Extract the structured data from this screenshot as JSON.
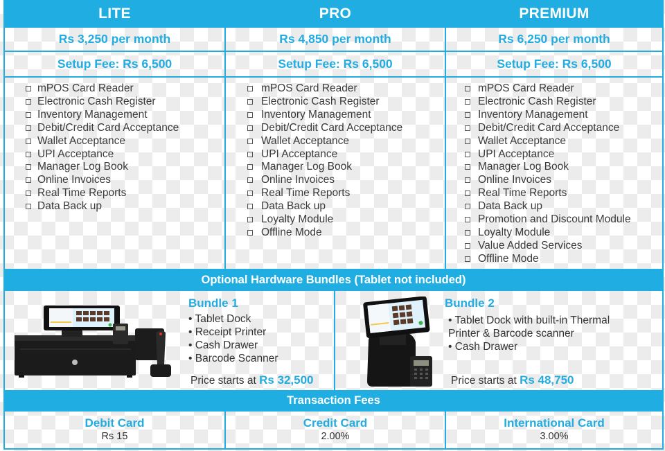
{
  "plans": [
    {
      "name": "LITE",
      "price": "Rs 3,250 per month",
      "setup_fee": "Setup Fee: Rs 6,500",
      "features": [
        "mPOS Card Reader",
        "Electronic Cash Register",
        "Inventory Management",
        "Debit/Credit Card Acceptance",
        "Wallet Acceptance",
        "UPI Acceptance",
        "Manager Log Book",
        "Online Invoices",
        "Real Time Reports",
        "Data Back up"
      ]
    },
    {
      "name": "PRO",
      "price": "Rs 4,850 per month",
      "setup_fee": "Setup Fee: Rs 6,500",
      "features": [
        "mPOS Card Reader",
        "Electronic Cash Register",
        "Inventory Management",
        "Debit/Credit Card Acceptance",
        "Wallet Acceptance",
        "UPI Acceptance",
        "Manager Log Book",
        "Online Invoices",
        "Real Time Reports",
        "Data Back up",
        "Loyalty Module",
        "Offline Mode"
      ]
    },
    {
      "name": "PREMIUM",
      "price": "Rs 6,250 per month",
      "setup_fee": "Setup Fee: Rs 6,500",
      "features": [
        "mPOS Card Reader",
        "Electronic Cash Register",
        "Inventory Management",
        "Debit/Credit Card Acceptance",
        "Wallet Acceptance",
        "UPI Acceptance",
        "Manager Log Book",
        "Online Invoices",
        "Real Time Reports",
        "Data Back up",
        "Promotion and Discount Module",
        "Loyalty Module",
        "Value Added Services",
        "Offline Mode"
      ]
    }
  ],
  "hardware": {
    "title": "Optional Hardware Bundles (Tablet not included)",
    "bundles": [
      {
        "name": "Bundle 1",
        "items": [
          "• Tablet Dock",
          "• Receipt Printer",
          "• Cash Drawer",
          "• Barcode Scanner"
        ],
        "price_prefix": "Price starts at ",
        "price": "Rs 32,500",
        "image": "pos-register-with-cash-drawer-and-scanner"
      },
      {
        "name": "Bundle 2",
        "items": [
          "• Tablet Dock with built-in Thermal Printer & Barcode scanner",
          "• Cash Drawer"
        ],
        "price_prefix": "Price starts at ",
        "price": "Rs 48,750",
        "image": "tablet-pos-stand-with-card-reader"
      }
    ]
  },
  "transaction_fees": {
    "title": "Transaction Fees",
    "items": [
      {
        "label": "Debit Card",
        "value": "Rs 15"
      },
      {
        "label": "Credit Card",
        "value": "2.00%"
      },
      {
        "label": "International Card",
        "value": "3.00%"
      }
    ]
  },
  "colors": {
    "accent": "#20aee2",
    "text": "#3a3a3a"
  }
}
